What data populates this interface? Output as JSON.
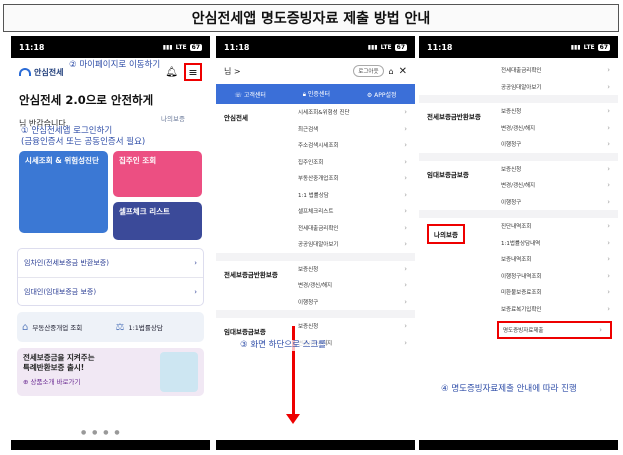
{
  "title": "안심전세앱 명도증빙자료 제출 방법 안내",
  "status": {
    "time": "11:18",
    "network": "LTE",
    "battery": "67"
  },
  "phone1": {
    "logo": "안심전세",
    "annotation_menu": "② 마이페이지로 이동하기",
    "annotation_login_1": "① 안심전세앱 로그인하기",
    "annotation_login_2": "(금융인증서 또는 공동인증서 필요)",
    "hero": "안심전세 2.0으로 안전하게",
    "greeting": "님 반갑습니다.",
    "hero_tag": "나의보증",
    "tiles": {
      "t1": "시세조회 & 위험성진단",
      "t2": "집주인 조회",
      "t3": "셀프체크 리스트"
    },
    "list": [
      "임차인(전세보증금 반환보증)",
      "임대인(임대보증금 보증)"
    ],
    "mini": [
      "부동산중개업 조회",
      "1:1법률상담"
    ],
    "banner_title_1": "전세보증금을 지켜주는",
    "banner_title_2": "특례반환보증 출시!",
    "banner_link": "⊕ 상품소개 바로가기"
  },
  "phone2": {
    "user": "님 >",
    "logout": "로그아웃",
    "bluebar": [
      "고객센터",
      "인증센터",
      "APP설정"
    ],
    "cat1": "안심전세",
    "cat1_items": [
      "시세조회&위험성 진단",
      "최근검색",
      "주소검색시세조회",
      "집주인조회",
      "부동산중개업조회",
      "1:1 법률상담",
      "셀프체크리스트",
      "전세대출금리확인",
      "공공임대알아보기"
    ],
    "cat2": "전세보증금반환보증",
    "cat2_items": [
      "보증신청",
      "변경/갱신/해지",
      "이행청구"
    ],
    "cat3": "임대보증금보증",
    "cat3_items": [
      "보증신청",
      "변경/갱신/해지"
    ],
    "annotation": "③ 화면 하단으로 스크롤"
  },
  "phone3": {
    "top_items": [
      "전세대출금리확인",
      "공공임대알아보기"
    ],
    "cat1": "전세보증금반환보증",
    "cat1_items": [
      "보증신청",
      "변경/갱신/해지",
      "이행청구"
    ],
    "cat2": "임대보증금보증",
    "cat2_items": [
      "보증신청",
      "변경/갱신/해지",
      "이행청구"
    ],
    "cat3": "나의보증",
    "cat3_items": [
      "진단내역조회",
      "1:1법률상담내역",
      "보증내역조회",
      "이행청구내역조회",
      "미환불보증료조회",
      "보증료복기입확인",
      "명도증빙자료제출"
    ],
    "annotation": "④ 명도증빙자료제출 안내에 따라 진행"
  }
}
